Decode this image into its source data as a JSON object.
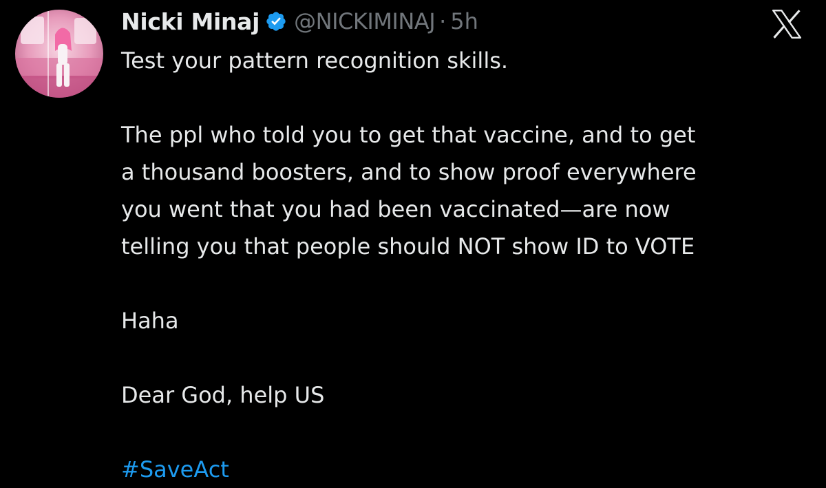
{
  "author": {
    "display_name": "Nicki Minaj",
    "handle": "@NICKIMINAJ",
    "separator": "·",
    "time_ago": "5h",
    "verified_color": "#1d9bf0"
  },
  "brand": {
    "logo_icon": "x-logo-icon"
  },
  "tweet": {
    "line1": "Test your pattern recognition skills.",
    "para2_lines": [
      "The ppl who told you to get that vaccine, and to get",
      "a thousand boosters, and to show proof everywhere",
      "you went that you had been vaccinated—are now",
      "telling you that people should NOT show ID to VOTE"
    ],
    "line3": "Haha",
    "line4": "Dear God, help US",
    "hashtag": "#SaveAct"
  },
  "colors": {
    "background": "#000000",
    "text": "#e7e9ea",
    "secondary": "#71767b",
    "link": "#1d9bf0"
  }
}
